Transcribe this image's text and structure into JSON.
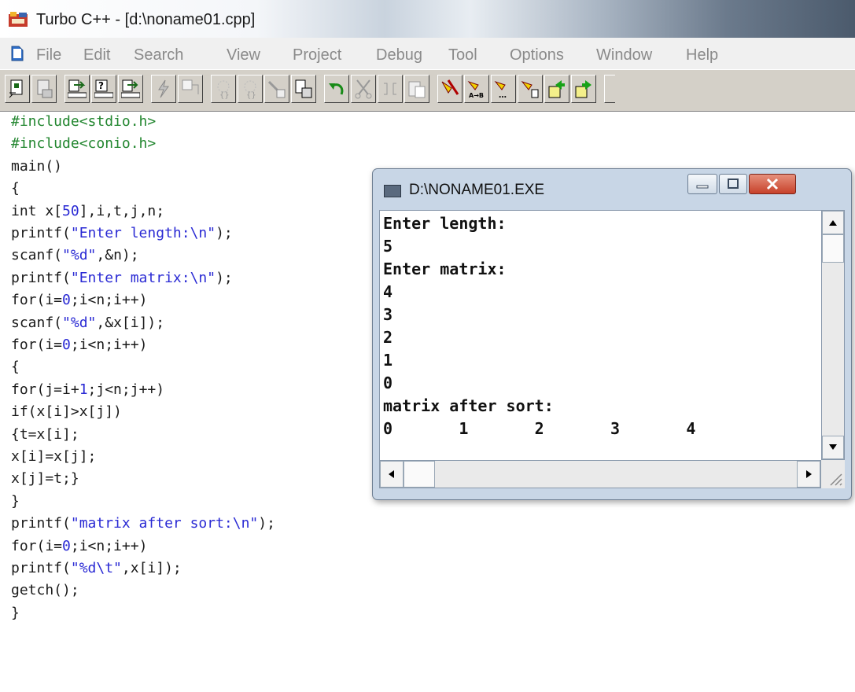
{
  "window": {
    "title": "Turbo C++ - [d:\\noname01.cpp]"
  },
  "menu": {
    "items": [
      "File",
      "Edit",
      "Search",
      "View",
      "Project",
      "Debug",
      "Tool",
      "Options",
      "Window",
      "Help"
    ]
  },
  "toolbar": {
    "buttons": [
      "new-file-icon",
      "save-icon",
      "compile-icon",
      "make-icon",
      "build-icon",
      "run-icon",
      "step-over-icon",
      "trace-into-icon",
      "breakpoint-icon",
      "watch-icon",
      "undo-icon",
      "cut-icon",
      "copy-icon",
      "paste-icon",
      "find-icon",
      "replace-icon",
      "search-again-icon",
      "go-to-icon",
      "previous-icon",
      "next-icon"
    ]
  },
  "editor": {
    "lines": [
      "#include<stdio.h>",
      "#include<conio.h>",
      "main()",
      "{",
      "int x[50],i,t,j,n;",
      "printf(\"Enter length:\\n\");",
      "scanf(\"%d\",&n);",
      "printf(\"Enter matrix:\\n\");",
      "for(i=0;i<n;i++)",
      "scanf(\"%d\",&x[i]);",
      "for(i=0;i<n;i++)",
      "{",
      "for(j=i+1;j<n;j++)",
      "if(x[i]>x[j])",
      "{t=x[i];",
      "x[i]=x[j];",
      "x[j]=t;}",
      "}",
      "printf(\"matrix after sort:\\n\");",
      "for(i=0;i<n;i++)",
      "printf(\"%d\\t\",x[i]);",
      "getch();",
      "}"
    ]
  },
  "console": {
    "title": "D:\\NONAME01.EXE",
    "lines": [
      "Enter length:",
      "5",
      "Enter matrix:",
      "4",
      "3",
      "2",
      "1",
      "0",
      "matrix after sort:",
      "0       1       2       3       4"
    ]
  },
  "colors": {
    "preprocessor": "#22862f",
    "string": "#2a2ad4",
    "console_frame": "#c8d6e6",
    "toolbar": "#d4d0c8"
  }
}
